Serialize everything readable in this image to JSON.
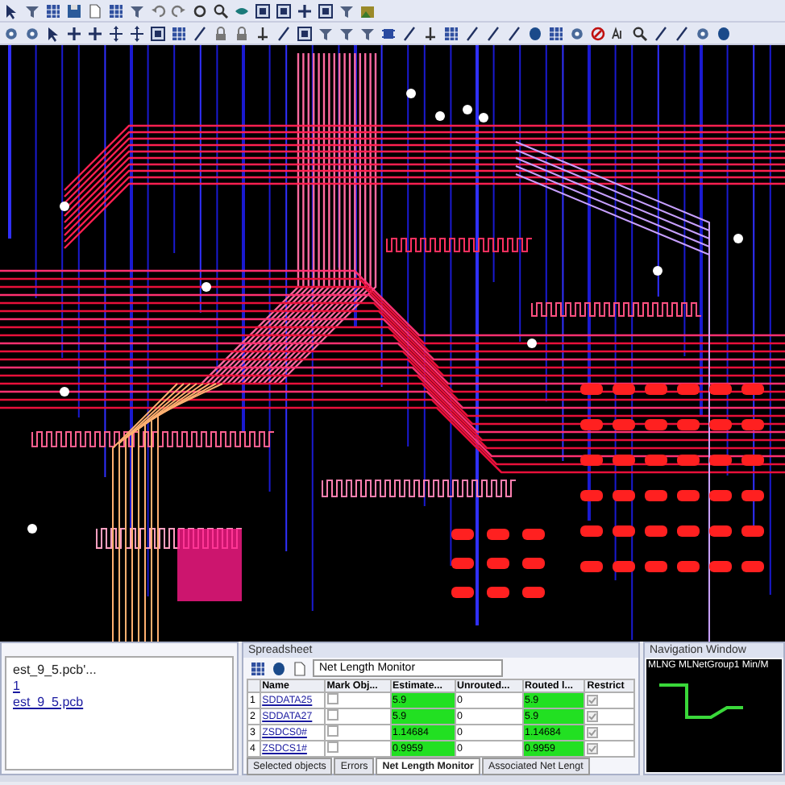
{
  "output_panel": {
    "lines": [
      {
        "text": "est_9_5.pcb'...",
        "link": false
      },
      {
        "text": "1",
        "link": true
      },
      {
        "text": "est_9_5.pcb",
        "link": true
      }
    ]
  },
  "spreadsheet": {
    "title": "Spreadsheet",
    "view": "Net Length Monitor",
    "columns": [
      "Name",
      "Mark Obj...",
      "Estimate...",
      "Unrouted...",
      "Routed l...",
      "Restrict"
    ],
    "rows": [
      {
        "index": "1",
        "name": "SDDATA25",
        "mark": false,
        "estimate": "5.9",
        "unrouted": "0",
        "routed": "5.9",
        "restrict": true,
        "ok": true
      },
      {
        "index": "2",
        "name": "SDDATA27",
        "mark": false,
        "estimate": "5.9",
        "unrouted": "0",
        "routed": "5.9",
        "restrict": true,
        "ok": true
      },
      {
        "index": "3",
        "name": "ZSDCS0#",
        "mark": false,
        "estimate": "1.14684",
        "unrouted": "0",
        "routed": "1.14684",
        "restrict": true,
        "ok": true
      },
      {
        "index": "4",
        "name": "ZSDCS1#",
        "mark": false,
        "estimate": "0.9959",
        "unrouted": "0",
        "routed": "0.9959",
        "restrict": true,
        "ok": true
      }
    ],
    "tabs": [
      {
        "label": "Selected objects",
        "selected": false
      },
      {
        "label": "Errors",
        "selected": false
      },
      {
        "label": "Net Length Monitor",
        "selected": true
      },
      {
        "label": "Associated Net Lengt",
        "selected": false
      }
    ]
  },
  "navigation": {
    "title": "Navigation Window",
    "label": "MLNG MLNetGroup1 Min/M"
  }
}
